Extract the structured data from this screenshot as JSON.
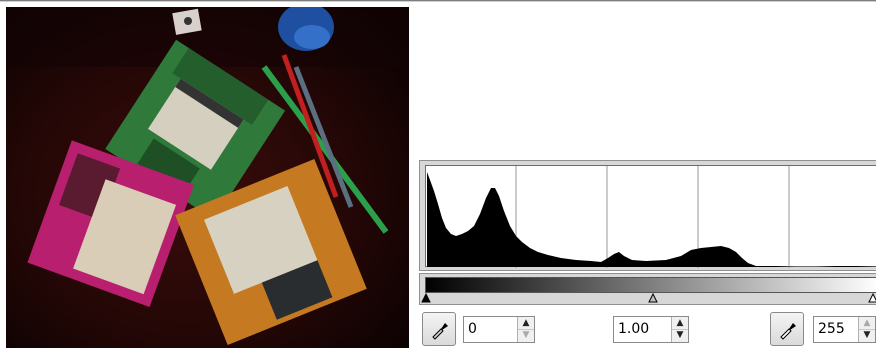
{
  "preview": {
    "icon": "image-preview"
  },
  "histogram": {
    "grid_lines": 4
  },
  "controls": {
    "low_picker_icon": "eyedropper-icon",
    "high_picker_icon": "eyedropper-icon",
    "low_input": "0",
    "gamma_input": "1.00",
    "high_input": "255",
    "up_arrow": "▲",
    "down_arrow": "▼"
  }
}
